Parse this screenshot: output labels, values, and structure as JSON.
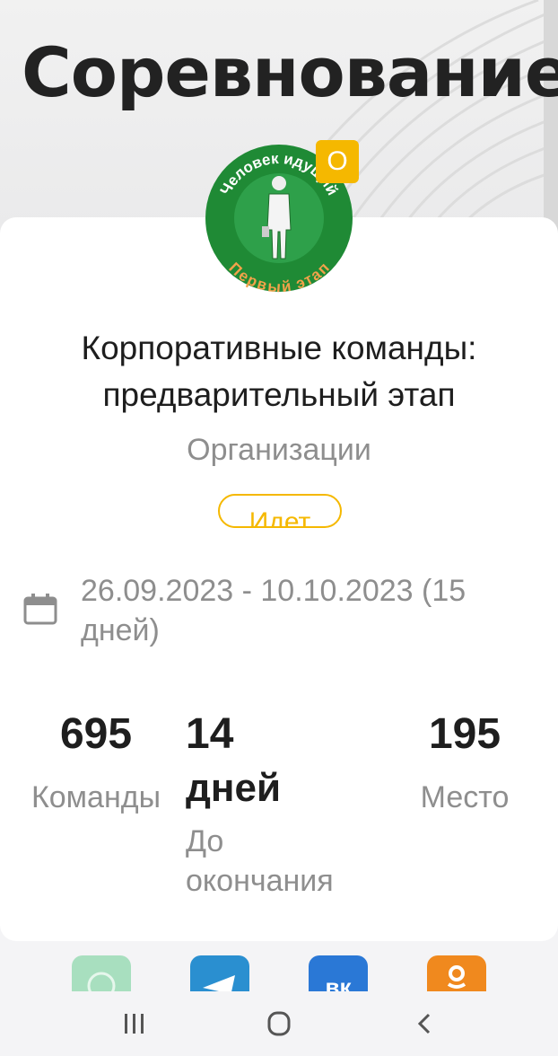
{
  "header": {
    "title": "Соревнование"
  },
  "logo": {
    "top_text": "Человек идущий",
    "bottom_text": "Первый этап",
    "badge": "О",
    "colors": {
      "ring": "#1f8a35",
      "text": "#f2a24a"
    }
  },
  "competition": {
    "title_line1": "Корпоративные команды:",
    "title_line2": "предварительный этап",
    "category": "Организации",
    "status": "Идет",
    "dates_line1": "26.09.2023 - 10.10.2023 (15",
    "dates_line2": "дней)"
  },
  "stats": {
    "teams": {
      "value": "695",
      "label": "Команды"
    },
    "days": {
      "value": "14",
      "unit": "дней",
      "label_line1": "До",
      "label_line2": "окончания"
    },
    "place": {
      "value": "195",
      "label": "Место"
    }
  },
  "share": {
    "icons": [
      "whatsapp-icon",
      "telegram-icon",
      "vk-icon",
      "odnoklassniki-icon"
    ],
    "vk_text": "вк"
  },
  "colors": {
    "accent": "#f5b800",
    "muted": "#8e8e8e",
    "telegram": "#2a8fd0",
    "vk": "#2a78d6",
    "ok": "#f0891e",
    "whatsapp": "#a8dfbf"
  }
}
